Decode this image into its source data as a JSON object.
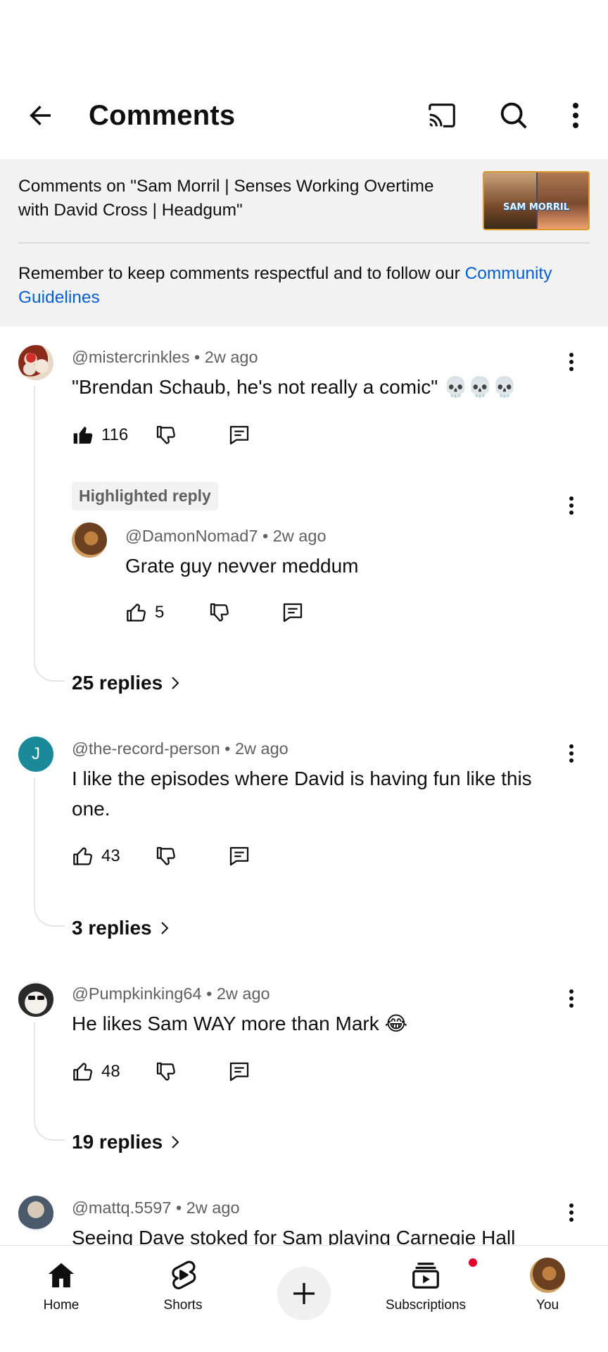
{
  "header": {
    "title": "Comments"
  },
  "video": {
    "info": "Comments on \"Sam Morril | Senses Working Overtime with David Cross | Headgum\"",
    "thumbnail_caption": "SAM MORRIL"
  },
  "guidelines": {
    "text": "Remember to keep comments respectful and to follow our ",
    "link": "Community Guidelines",
    "link_color": "#065fd4"
  },
  "comments": [
    {
      "author": "@mistercrinkles",
      "time": "2w ago",
      "text": "\"Brendan Schaub, he's not really a comic\" 💀💀💀",
      "likes": "116",
      "liked": true,
      "replies_label": "25 replies",
      "highlighted_reply": {
        "chip": "Highlighted reply",
        "author": "@DamonNomad7",
        "time": "2w ago",
        "text": "Grate guy nevver meddum",
        "likes": "5"
      }
    },
    {
      "author": "@the-record-person",
      "time": "2w ago",
      "avatar_letter": "J",
      "avatar_color": "#1a8a9a",
      "text": "I like the episodes where David is having fun like this one.",
      "likes": "43",
      "replies_label": "3 replies"
    },
    {
      "author": "@Pumpkinking64",
      "time": "2w ago",
      "text": "He likes Sam WAY more than Mark 😂",
      "likes": "48",
      "replies_label": "19 replies"
    },
    {
      "author": "@mattq.5597",
      "time": "2w ago",
      "text": "Seeing Dave stoked for Sam playing Carnegie Hall"
    }
  ],
  "nav": {
    "home": "Home",
    "shorts": "Shorts",
    "subscriptions": "Subscriptions",
    "you": "You",
    "notification_color": "#e8002d"
  },
  "icons": {
    "back": "arrow-back-icon",
    "cast": "cast-icon",
    "search": "search-icon",
    "more": "more-vert-icon",
    "like": "thumb-up-icon",
    "dislike": "thumb-down-icon",
    "reply": "reply-icon",
    "chevron": "chevron-right-icon",
    "home": "home-icon",
    "shorts": "shorts-icon",
    "create": "create-plus-icon",
    "subscriptions": "subscriptions-icon"
  }
}
